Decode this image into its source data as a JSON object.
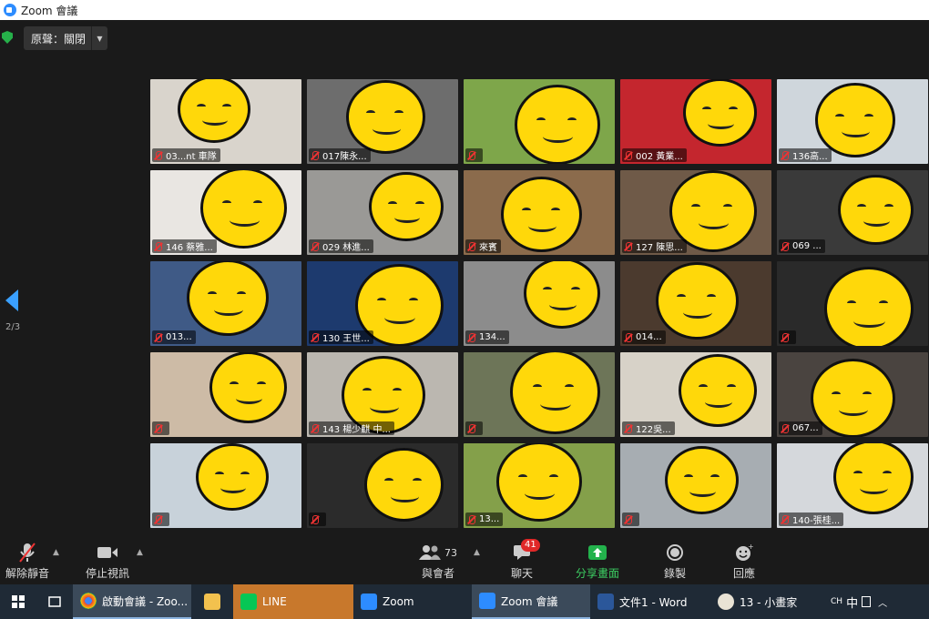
{
  "window": {
    "title": "Zoom 會議"
  },
  "topbar": {
    "original_sound_label": "原聲：關閉"
  },
  "pagination": {
    "current_page": "2/3"
  },
  "tiles": [
    {
      "name": "03...nt 車隊"
    },
    {
      "name": "017陳永..."
    },
    {
      "name": ""
    },
    {
      "name": "002 黃業..."
    },
    {
      "name": "136高..."
    },
    {
      "name": "146 蔡雅..."
    },
    {
      "name": "029 林進..."
    },
    {
      "name": "來賓"
    },
    {
      "name": "127 陳思..."
    },
    {
      "name": "069 ..."
    },
    {
      "name": "013..."
    },
    {
      "name": "130 王世..."
    },
    {
      "name": "134..."
    },
    {
      "name": "014..."
    },
    {
      "name": ""
    },
    {
      "name": ""
    },
    {
      "name": "143 楊少麒 中..."
    },
    {
      "name": ""
    },
    {
      "name": "122吳..."
    },
    {
      "name": "067..."
    },
    {
      "name": ""
    },
    {
      "name": ""
    },
    {
      "name": "13..."
    },
    {
      "name": ""
    },
    {
      "name": "140-張桂..."
    }
  ],
  "controls": {
    "unmute": "解除靜音",
    "start_video": "停止視訊",
    "participants": "與會者",
    "participants_count": "73",
    "chat": "聊天",
    "chat_badge": "41",
    "share_screen": "分享畫面",
    "record": "錄製",
    "reactions": "回應"
  },
  "taskbar": {
    "items": [
      {
        "label": "啟動會議 - Zoo..."
      },
      {
        "label": "LINE"
      },
      {
        "label": "Zoom"
      },
      {
        "label": "Zoom 會議"
      },
      {
        "label": "文件1 - Word"
      },
      {
        "label": "13 - 小畫家"
      }
    ],
    "ime": "中",
    "lang": "CH"
  },
  "colors": {
    "accent": "#2d8cff",
    "share_green": "#23b24c",
    "chat_badge": "#e02828",
    "sticker": "#ffd80a"
  }
}
